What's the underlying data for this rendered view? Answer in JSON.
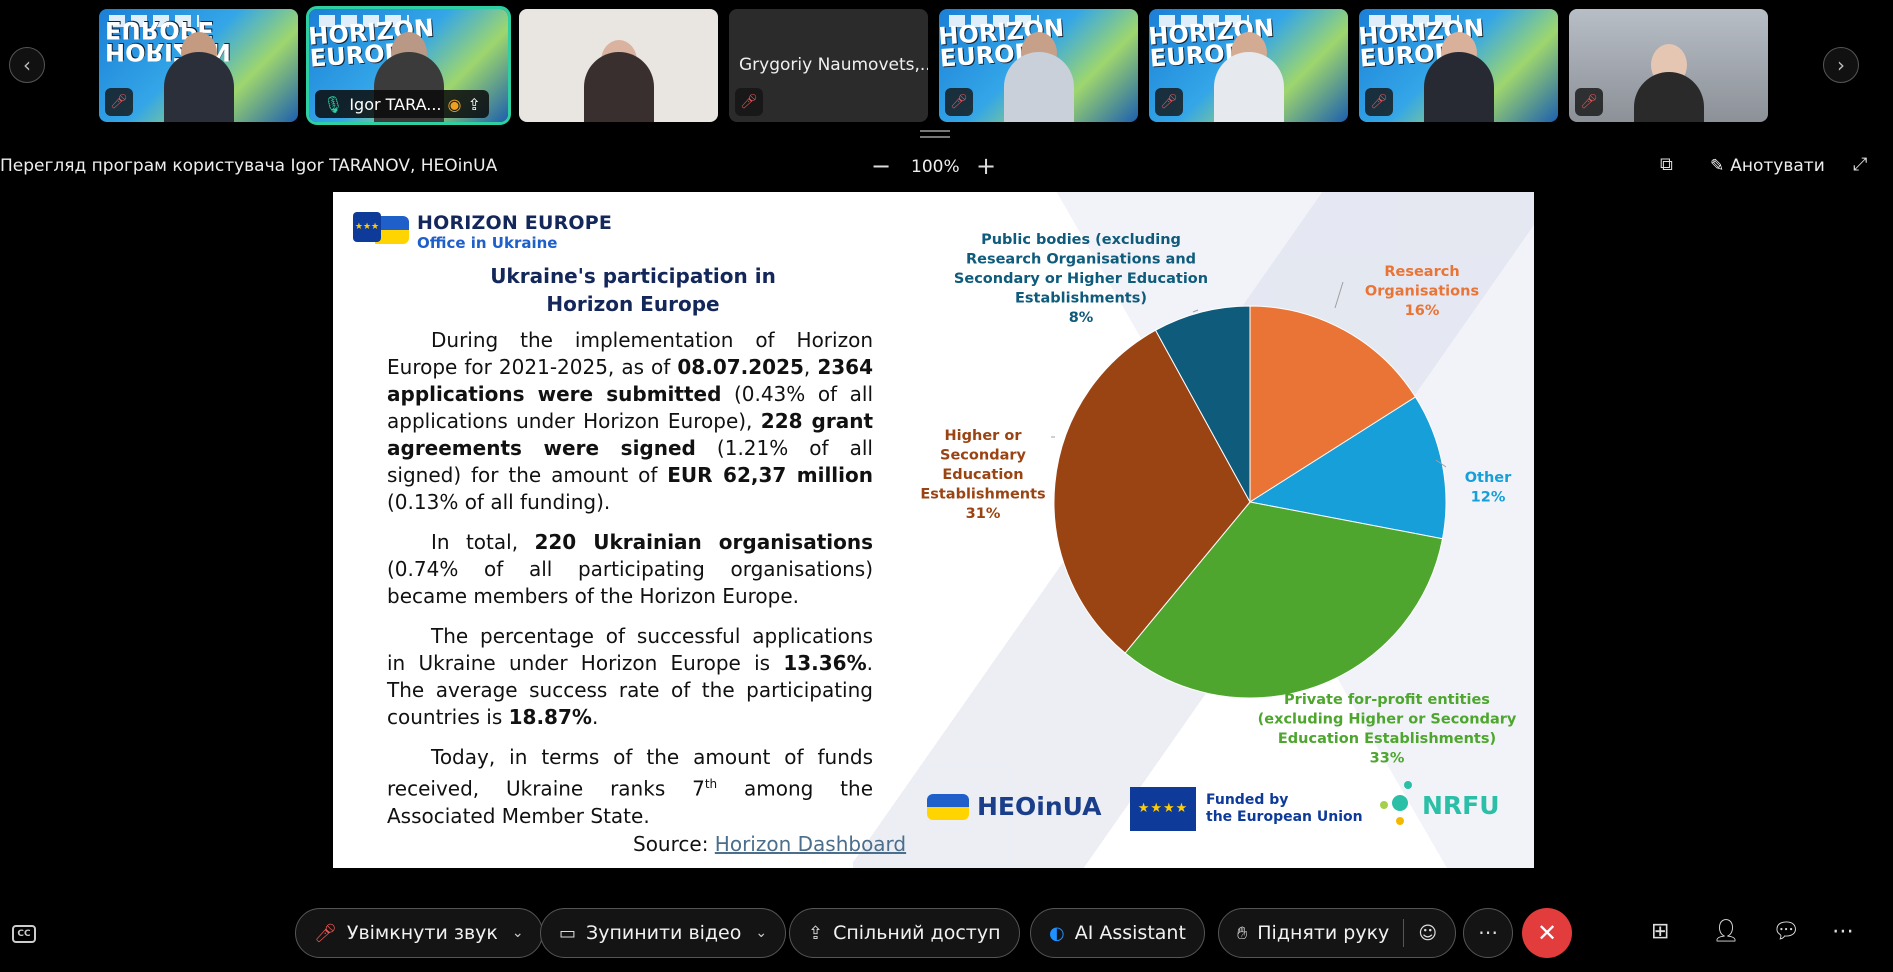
{
  "thumbnails": {
    "tiles": [
      {
        "kind": "horizon",
        "word": "HORIZON EUROPE"
      },
      {
        "kind": "horizon",
        "word": "HORIZON EUROPE",
        "name": "Igor  TARA..."
      },
      {
        "kind": "light"
      },
      {
        "kind": "dark",
        "name": "Grygoriy Naumovets,..."
      },
      {
        "kind": "horizon",
        "word": "HORIZON EUROPE"
      },
      {
        "kind": "horizon",
        "word": "HORIZON EUROPE"
      },
      {
        "kind": "horizon",
        "word": "HORIZON EUROPE"
      },
      {
        "kind": "blurry"
      }
    ]
  },
  "share": {
    "title": "Перегляд програм користувача Igor  TARANOV, HEOinUA",
    "zoom": "100%",
    "annotate_label": "Анотувати"
  },
  "slide": {
    "logo_line1": "HORIZON EUROPE",
    "logo_line2": "Office in Ukraine",
    "title_line1": "Ukraine's participation in",
    "title_line2": "Horizon Europe",
    "source_label": "Source: ",
    "source_link": "Horizon Dashboard",
    "footer_heo": "HEOinUA",
    "footer_eu_line1": "Funded by",
    "footer_eu_line2": "the European Union",
    "footer_nrfu": "NRFU"
  },
  "chart_data": {
    "type": "pie",
    "slices": [
      {
        "label": "Research Organisations",
        "value": 16,
        "color": "#e97435"
      },
      {
        "label": "Other",
        "value": 12,
        "color": "#169fd9"
      },
      {
        "label": "Private for-profit entities (excluding Higher or Secondary Education Establishments)",
        "value": 33,
        "color": "#4ea62f"
      },
      {
        "label": "Higher or Secondary Education Establishments",
        "value": 31,
        "color": "#9b4413"
      },
      {
        "label": "Public bodies (excluding Research Organisations and Secondary or Higher Education Establishments)",
        "value": 8,
        "color": "#0f5b7c"
      }
    ]
  },
  "pie_labels": [
    {
      "lines": [
        "Research",
        "Organisations",
        "16%"
      ],
      "color": "#e97435"
    },
    {
      "lines": [
        "Other",
        "12%"
      ],
      "color": "#169fd9"
    },
    {
      "lines": [
        "Private for-profit entities",
        "(excluding Higher or Secondary",
        "Education Establishments)",
        "33%"
      ],
      "color": "#4ea62f"
    },
    {
      "lines": [
        "Higher or",
        "Secondary",
        "Education",
        "Establishments",
        "31%"
      ],
      "color": "#9b4413"
    },
    {
      "lines": [
        "Public bodies (excluding",
        "Research Organisations and",
        "Secondary or Higher Education",
        "Establishments)",
        "8%"
      ],
      "color": "#0f5b7c"
    }
  ],
  "controls": {
    "unmute": "Увімкнути звук",
    "stop_video": "Зупинити відео",
    "share": "Спільний доступ",
    "ai": "AI Assistant",
    "raise_hand": "Підняти руку"
  }
}
